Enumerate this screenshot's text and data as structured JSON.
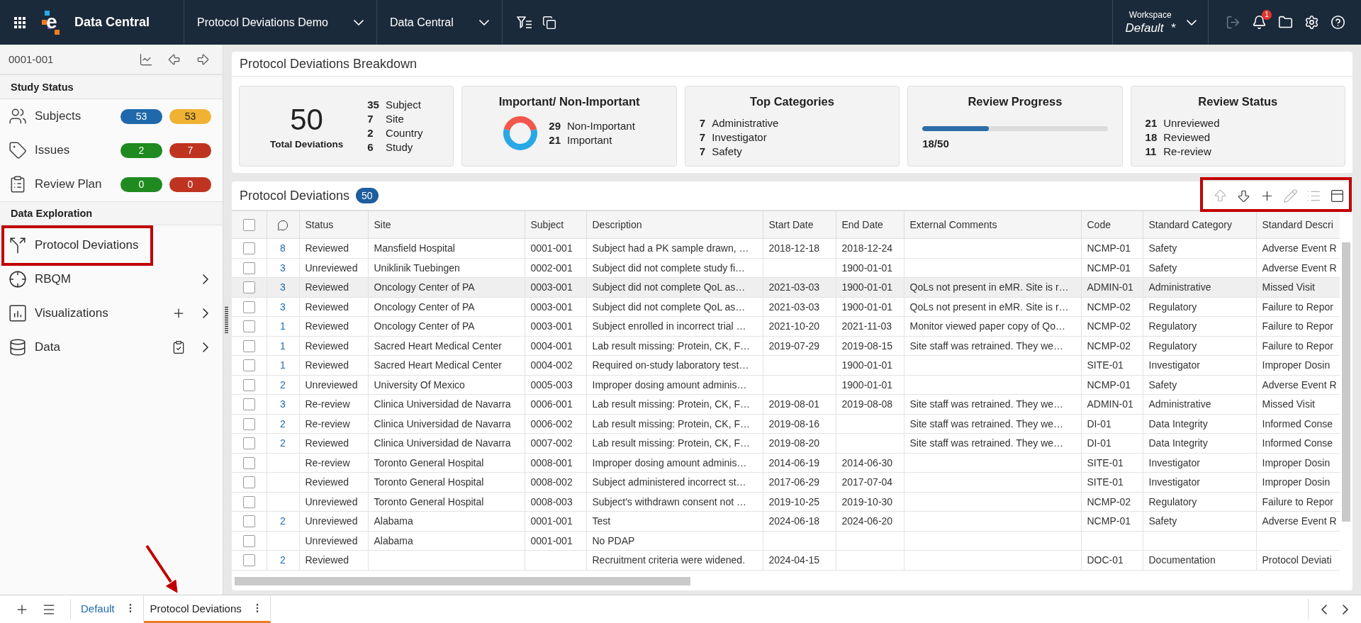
{
  "top_bar": {
    "logo_mark": "e",
    "app_name": "Data Central",
    "menus": [
      {
        "label": "Protocol Deviations Demo"
      },
      {
        "label": "Data Central"
      }
    ],
    "tools": [
      {
        "kind": "filter"
      },
      {
        "kind": "copy"
      }
    ],
    "workspace": {
      "label": "Workspace",
      "value": "Default",
      "marker": "*"
    },
    "actions": [
      {
        "kind": "logout",
        "disabled": true
      },
      {
        "kind": "notifications",
        "disabled": false,
        "badge": "1"
      },
      {
        "kind": "folder",
        "disabled": false
      },
      {
        "kind": "settings",
        "disabled": false
      },
      {
        "kind": "help",
        "disabled": false
      }
    ]
  },
  "sidebar": {
    "subject": "0001-001",
    "subject_tools": [
      {
        "kind": "chart"
      },
      {
        "kind": "previous"
      },
      {
        "kind": "next"
      }
    ],
    "sections": [
      {
        "kind": "status",
        "title": "Study Status",
        "items": [
          {
            "kind": "subjects",
            "label": "Subjects",
            "badges": [
              {
                "value": "53",
                "color": "#1f69ab"
              },
              {
                "value": "53",
                "color": "#f0b232"
              }
            ]
          },
          {
            "kind": "issues",
            "label": "Issues",
            "badges": [
              {
                "value": "2",
                "color": "#1e8a1f"
              },
              {
                "value": "7",
                "color": "#bf3421"
              }
            ]
          },
          {
            "kind": "review_plan",
            "label": "Review Plan",
            "badges": [
              {
                "value": "0",
                "color": "#1e8a1f"
              },
              {
                "value": "0",
                "color": "#bf3421"
              }
            ]
          }
        ]
      },
      {
        "kind": "nav",
        "title": "Data Exploration",
        "items": [
          {
            "kind": "deviations",
            "label": "Protocol Deviations",
            "highlighted": true,
            "expandable": false
          },
          {
            "kind": "rbqm",
            "label": "RBQM",
            "highlighted": false,
            "expandable": true
          },
          {
            "kind": "visualizations",
            "label": "Visualizations",
            "highlighted": false,
            "expandable": true
          },
          {
            "kind": "data",
            "label": "Data",
            "highlighted": false,
            "expandable": true
          }
        ]
      }
    ]
  },
  "breakdown": {
    "title": "Protocol Deviations Breakdown",
    "cards": [
      {
        "kind": "total",
        "value": "50",
        "label": "Total Deviations",
        "items": [
          {
            "count": "35",
            "label": "Subject"
          },
          {
            "count": "7",
            "label": "Site"
          },
          {
            "count": "2",
            "label": "Country"
          },
          {
            "count": "6",
            "label": "Study"
          }
        ]
      },
      {
        "kind": "donut",
        "title": "Important/ Non-Important",
        "chart_data": {
          "type": "donut",
          "categories": [
            "Non-Important",
            "Important"
          ],
          "values": [
            29,
            21
          ],
          "data_labels": true
        }
      },
      {
        "kind": "list",
        "title": "Top Categories",
        "items": [
          {
            "count": "7",
            "label": "Administrative"
          },
          {
            "count": "7",
            "label": "Investigator"
          },
          {
            "count": "7",
            "label": "Safety"
          }
        ]
      },
      {
        "kind": "progress",
        "title": "Review Progress",
        "level": 0.36,
        "reading": "18/50"
      },
      {
        "kind": "list",
        "title": "Review Status",
        "items": [
          {
            "count": "21",
            "label": "Unreviewed"
          },
          {
            "count": "18",
            "label": "Reviewed"
          },
          {
            "count": "11",
            "label": "Re-review"
          }
        ]
      }
    ]
  },
  "deviations_panel": {
    "title": "Protocol Deviations",
    "count": "50",
    "highlighted": true,
    "toolbar": [
      {
        "kind": "up",
        "disabled": true
      },
      {
        "kind": "down",
        "disabled": false
      },
      {
        "kind": "add",
        "disabled": false
      },
      {
        "kind": "edit",
        "disabled": true
      },
      {
        "kind": "list",
        "disabled": true
      },
      {
        "kind": "layout",
        "disabled": false
      }
    ],
    "table": {
      "all_checked": false,
      "columns": [
        "Status",
        "Site",
        "Subject",
        "Description",
        "Start Date",
        "End Date",
        "External Comments",
        "Code",
        "Standard Category",
        "Standard Descri"
      ],
      "rows": [
        {
          "checked": false,
          "highlighted": false,
          "comments": "8",
          "cells": [
            "Reviewed",
            "Mansfield Hospital",
            "0001-001",
            "Subject had a PK sample drawn, …",
            "2018-12-18",
            "2018-12-24",
            null,
            "NCMP-01",
            "Safety",
            "Adverse Event R"
          ]
        },
        {
          "checked": false,
          "highlighted": false,
          "comments": "3",
          "cells": [
            "Unreviewed",
            "Uniklinik Tuebingen",
            "0002-001",
            "Subject did not complete study fi…",
            null,
            "1900-01-01",
            null,
            "NCMP-01",
            "Safety",
            "Adverse Event R"
          ]
        },
        {
          "checked": false,
          "highlighted": true,
          "comments": "3",
          "cells": [
            "Reviewed",
            "Oncology Center of PA",
            "0003-001",
            "Subject did not complete QoL as…",
            "2021-03-03",
            "1900-01-01",
            "QoLs not present in eMR. Site is r…",
            "ADMIN-01",
            "Administrative",
            "Missed Visit"
          ]
        },
        {
          "checked": false,
          "highlighted": false,
          "comments": "3",
          "cells": [
            "Reviewed",
            "Oncology Center of PA",
            "0003-001",
            "Subject did not complete QoL as…",
            "2021-03-03",
            "1900-01-01",
            "QoLs not present in eMR. Site is r…",
            "NCMP-02",
            "Regulatory",
            "Failure to Repor"
          ]
        },
        {
          "checked": false,
          "highlighted": false,
          "comments": "1",
          "cells": [
            "Reviewed",
            "Oncology Center of PA",
            "0003-001",
            "Subject enrolled in incorrect trial …",
            "2021-10-20",
            "2021-11-03",
            "Monitor viewed paper copy of Qo…",
            "NCMP-02",
            "Regulatory",
            "Failure to Repor"
          ]
        },
        {
          "checked": false,
          "highlighted": false,
          "comments": "1",
          "cells": [
            "Reviewed",
            "Sacred Heart Medical Center",
            "0004-001",
            "Lab result missing: Protein, CK, F…",
            "2019-07-29",
            "2019-08-15",
            "Site staff was retrained. They we…",
            "NCMP-02",
            "Regulatory",
            "Failure to Repor"
          ]
        },
        {
          "checked": false,
          "highlighted": false,
          "comments": "1",
          "cells": [
            "Reviewed",
            "Sacred Heart Medical Center",
            "0004-002",
            "Required on-study laboratory test…",
            null,
            "1900-01-01",
            null,
            "SITE-01",
            "Investigator",
            "Improper Dosin"
          ]
        },
        {
          "checked": false,
          "highlighted": false,
          "comments": "2",
          "cells": [
            "Unreviewed",
            "University Of Mexico",
            "0005-003",
            "Improper dosing amount adminis…",
            null,
            "1900-01-01",
            null,
            "NCMP-01",
            "Safety",
            "Adverse Event R"
          ]
        },
        {
          "checked": false,
          "highlighted": false,
          "comments": "3",
          "cells": [
            "Re-review",
            "Clinica Universidad de Navarra",
            "0006-001",
            "Lab result missing: Protein, CK, F…",
            "2019-08-01",
            "2019-08-08",
            "Site staff was retrained. They we…",
            "ADMIN-01",
            "Administrative",
            "Missed Visit"
          ]
        },
        {
          "checked": false,
          "highlighted": false,
          "comments": "2",
          "cells": [
            "Re-review",
            "Clinica Universidad de Navarra",
            "0006-002",
            "Lab result missing: Protein, CK, F…",
            "2019-08-16",
            null,
            "Site staff was retrained. They we…",
            "DI-01",
            "Data Integrity",
            "Informed Conse"
          ]
        },
        {
          "checked": false,
          "highlighted": false,
          "comments": "2",
          "cells": [
            "Reviewed",
            "Clinica Universidad de Navarra",
            "0007-002",
            "Lab result missing: Protein, CK, F…",
            "2019-08-20",
            null,
            "Site staff was retrained. They we…",
            "DI-01",
            "Data Integrity",
            "Informed Conse"
          ]
        },
        {
          "checked": false,
          "highlighted": false,
          "cells": [
            "Re-review",
            "Toronto General Hospital",
            "0008-001",
            "Improper dosing amount adminis…",
            "2014-06-19",
            "2014-06-30",
            null,
            "SITE-01",
            "Investigator",
            "Improper Dosin"
          ]
        },
        {
          "checked": false,
          "highlighted": false,
          "cells": [
            "Reviewed",
            "Toronto General Hospital",
            "0008-002",
            "Subject administered incorrect st…",
            "2017-06-29",
            "2017-07-04",
            null,
            "SITE-01",
            "Investigator",
            "Improper Dosin"
          ]
        },
        {
          "checked": false,
          "highlighted": false,
          "cells": [
            "Unreviewed",
            "Toronto General Hospital",
            "0008-003",
            "Subject's withdrawn consent not …",
            "2019-10-25",
            "2019-10-30",
            null,
            "NCMP-02",
            "Regulatory",
            "Failure to Repor"
          ]
        },
        {
          "checked": false,
          "highlighted": false,
          "comments": "2",
          "cells": [
            "Unreviewed",
            "Alabama",
            "0001-001",
            "Test",
            "2024-06-18",
            "2024-06-20",
            null,
            "NCMP-01",
            "Safety",
            "Adverse Event R"
          ]
        },
        {
          "checked": false,
          "highlighted": false,
          "cells": [
            "Unreviewed",
            "Alabama",
            "0001-001",
            "No PDAP",
            null,
            null,
            null,
            null,
            null,
            null
          ]
        },
        {
          "checked": false,
          "highlighted": false,
          "comments": "2",
          "cells": [
            "Reviewed",
            null,
            null,
            "Recruitment criteria were widened.",
            "2024-04-15",
            null,
            null,
            "DOC-01",
            "Documentation",
            "Protocol Deviati"
          ]
        }
      ]
    }
  },
  "bottom_bar": {
    "tabs": [
      {
        "label": "Default",
        "selected": false,
        "pointed": false
      },
      {
        "label": "Protocol Deviations",
        "selected": true,
        "pointed": true
      }
    ]
  }
}
